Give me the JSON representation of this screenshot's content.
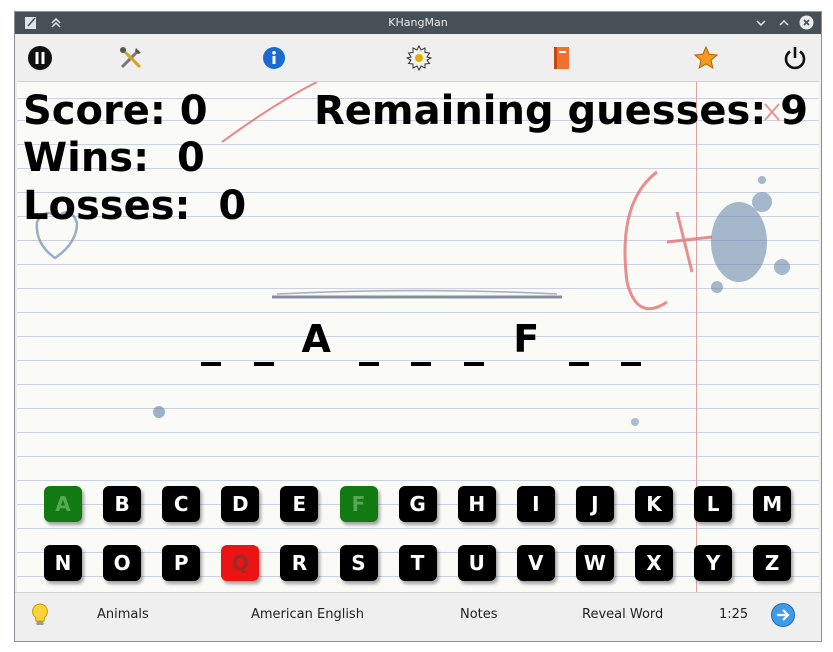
{
  "window": {
    "title": "KHangMan"
  },
  "toolbar": {
    "icons": [
      "pause-icon",
      "settings-tools-icon",
      "info-icon",
      "new-game-icon",
      "book-icon",
      "star-icon",
      "power-icon"
    ]
  },
  "stats": {
    "score_label": "Score:",
    "score_value": "0",
    "remaining_label": "Remaining guesses:",
    "remaining_value": "9",
    "wins_label": "Wins:",
    "wins_value": "0",
    "losses_label": "Losses:",
    "losses_value": "0"
  },
  "word": [
    "_",
    "_",
    "A",
    "_",
    "_",
    "_",
    "F",
    "_",
    "_"
  ],
  "keyboard": {
    "row1": [
      {
        "letter": "A",
        "state": "correct"
      },
      {
        "letter": "B",
        "state": "unused"
      },
      {
        "letter": "C",
        "state": "unused"
      },
      {
        "letter": "D",
        "state": "unused"
      },
      {
        "letter": "E",
        "state": "unused"
      },
      {
        "letter": "F",
        "state": "correct"
      },
      {
        "letter": "G",
        "state": "unused"
      },
      {
        "letter": "H",
        "state": "unused"
      },
      {
        "letter": "I",
        "state": "unused"
      },
      {
        "letter": "J",
        "state": "unused"
      },
      {
        "letter": "K",
        "state": "unused"
      },
      {
        "letter": "L",
        "state": "unused"
      },
      {
        "letter": "M",
        "state": "unused"
      }
    ],
    "row2": [
      {
        "letter": "N",
        "state": "unused"
      },
      {
        "letter": "O",
        "state": "unused"
      },
      {
        "letter": "P",
        "state": "unused"
      },
      {
        "letter": "Q",
        "state": "wrong"
      },
      {
        "letter": "R",
        "state": "unused"
      },
      {
        "letter": "S",
        "state": "unused"
      },
      {
        "letter": "T",
        "state": "unused"
      },
      {
        "letter": "U",
        "state": "unused"
      },
      {
        "letter": "V",
        "state": "unused"
      },
      {
        "letter": "W",
        "state": "unused"
      },
      {
        "letter": "X",
        "state": "unused"
      },
      {
        "letter": "Y",
        "state": "unused"
      },
      {
        "letter": "Z",
        "state": "unused"
      }
    ]
  },
  "statusbar": {
    "hint_icon": "lightbulb-icon",
    "category": "Animals",
    "language": "American English",
    "theme": "Notes",
    "reveal": "Reveal Word",
    "timer": "1:25",
    "next_icon": "arrow-right-circle-icon"
  },
  "colors": {
    "correct": "#127a12",
    "wrong": "#ea1414",
    "key": "#000000",
    "titlebar": "#475057"
  }
}
